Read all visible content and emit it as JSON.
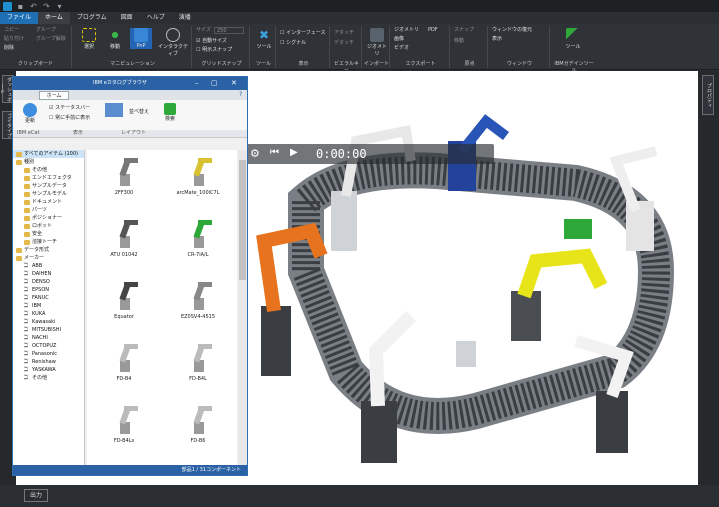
{
  "menus": [
    "ファイル",
    "ホーム",
    "プログラム",
    "図面",
    "ヘルプ",
    "演播"
  ],
  "ribbon_groups": [
    {
      "label": "クリップボード",
      "items": [
        "コピー",
        "貼り付け",
        "削除",
        "グループ",
        "グループ解除"
      ]
    },
    {
      "label": "マニピュレーション",
      "items": [
        "選択",
        "移動",
        "PnP",
        "インタラクティブ"
      ]
    },
    {
      "label": "グリッドスナップ",
      "items": [
        "サイズ",
        "自動サイズ",
        "明示スナップ"
      ],
      "size_value": "250"
    },
    {
      "label": "ツール",
      "items": [
        "ツール"
      ]
    },
    {
      "label": "表示",
      "items": [
        "インターフェース",
        "シグナル"
      ]
    },
    {
      "label": "ビエラルキー",
      "items": [
        "アタッチ",
        "デタッチ"
      ]
    },
    {
      "label": "インポート",
      "items": [
        "ジオメトリ"
      ]
    },
    {
      "label": "エクスポート",
      "items": [
        "ジオメトリ",
        "画像",
        "ビデオ",
        "PDF"
      ]
    },
    {
      "label": "原点",
      "items": [
        "スナップ",
        "移動"
      ]
    },
    {
      "label": "ウィンドウ",
      "items": [
        "ウィンドウの復元",
        "表示"
      ]
    },
    {
      "label": "IBMガデインツール",
      "items": [
        "ツール"
      ]
    }
  ],
  "left_tabs": [
    "ダッシュボード",
    "ゴミタイプ"
  ],
  "right_tab": "プロパティ",
  "player_time": "0:00:00",
  "output_button": "出力",
  "browser": {
    "title": "IBM eカタログブラウザ",
    "tab": "ホーム",
    "update_label": "更新",
    "checkbox_status": "ステータスバー",
    "checkbox_front": "常に手前に表示",
    "sort_label": "並べ替え",
    "search_label": "検索",
    "group_display": "表示",
    "group_layout": "レイアウト",
    "group_ibm": "IBM eCat",
    "status_text": "部品1 / 31コンポーネント",
    "tree": [
      {
        "label": "すべてのアイテム (100)",
        "type": "folder",
        "level": 0
      },
      {
        "label": "種別",
        "type": "folder",
        "level": 0
      },
      {
        "label": "その他",
        "type": "folder",
        "level": 1
      },
      {
        "label": "エンドエフェクタ",
        "type": "folder",
        "level": 1
      },
      {
        "label": "サンプルデータ",
        "type": "folder",
        "level": 1
      },
      {
        "label": "サンプルモデル",
        "type": "folder",
        "level": 1
      },
      {
        "label": "ドキュメント",
        "type": "folder",
        "level": 1
      },
      {
        "label": "パーツ",
        "type": "folder",
        "level": 1
      },
      {
        "label": "ポジショナー",
        "type": "folder",
        "level": 1
      },
      {
        "label": "ロボット",
        "type": "folder",
        "level": 1
      },
      {
        "label": "安全",
        "type": "folder",
        "level": 1
      },
      {
        "label": "溶接トーチ",
        "type": "folder",
        "level": 1
      },
      {
        "label": "データ形式",
        "type": "folder",
        "level": 0
      },
      {
        "label": "メーカー",
        "type": "folder",
        "level": 0
      },
      {
        "label": "ABB",
        "type": "robot",
        "level": 1
      },
      {
        "label": "DAIHEN",
        "type": "robot",
        "level": 1
      },
      {
        "label": "DENSO",
        "type": "robot",
        "level": 1
      },
      {
        "label": "EPSON",
        "type": "robot",
        "level": 1
      },
      {
        "label": "FANUC",
        "type": "robot",
        "level": 1
      },
      {
        "label": "IBM",
        "type": "robot",
        "level": 1
      },
      {
        "label": "KUKA",
        "type": "robot",
        "level": 1
      },
      {
        "label": "Kawasaki",
        "type": "robot",
        "level": 1
      },
      {
        "label": "MITSUBISHI",
        "type": "robot",
        "level": 1
      },
      {
        "label": "NACHI",
        "type": "robot",
        "level": 1
      },
      {
        "label": "OCTOPUZ",
        "type": "robot",
        "level": 1
      },
      {
        "label": "Panasonic",
        "type": "robot",
        "level": 1
      },
      {
        "label": "Renishaw",
        "type": "robot",
        "level": 1
      },
      {
        "label": "YASKAWA",
        "type": "robot",
        "level": 1
      },
      {
        "label": "その他",
        "type": "robot",
        "level": 1
      }
    ],
    "items": [
      {
        "caption": "2FF300",
        "color": "#777777"
      },
      {
        "caption": "arcMate_100iC7L",
        "color": "#d9c232"
      },
      {
        "caption": "ATU 01042",
        "color": "#555555"
      },
      {
        "caption": "CR-7iA/L",
        "color": "#2fa83a"
      },
      {
        "caption": "Equator",
        "color": "#444444"
      },
      {
        "caption": "EZ0SV4-4515",
        "color": "#888888"
      },
      {
        "caption": "FD-B4",
        "color": "#bbbbbb"
      },
      {
        "caption": "FD-B4L",
        "color": "#bbbbbb"
      },
      {
        "caption": "FD-B4Ls",
        "color": "#bbbbbb"
      },
      {
        "caption": "FD-B6",
        "color": "#bbbbbb"
      }
    ]
  },
  "colors": {
    "accent": "#1f6fb5",
    "browser_title": "#2a62a5",
    "robot_orange": "#e8731e",
    "robot_yellow": "#e7e51a",
    "robot_blue": "#23439a"
  }
}
